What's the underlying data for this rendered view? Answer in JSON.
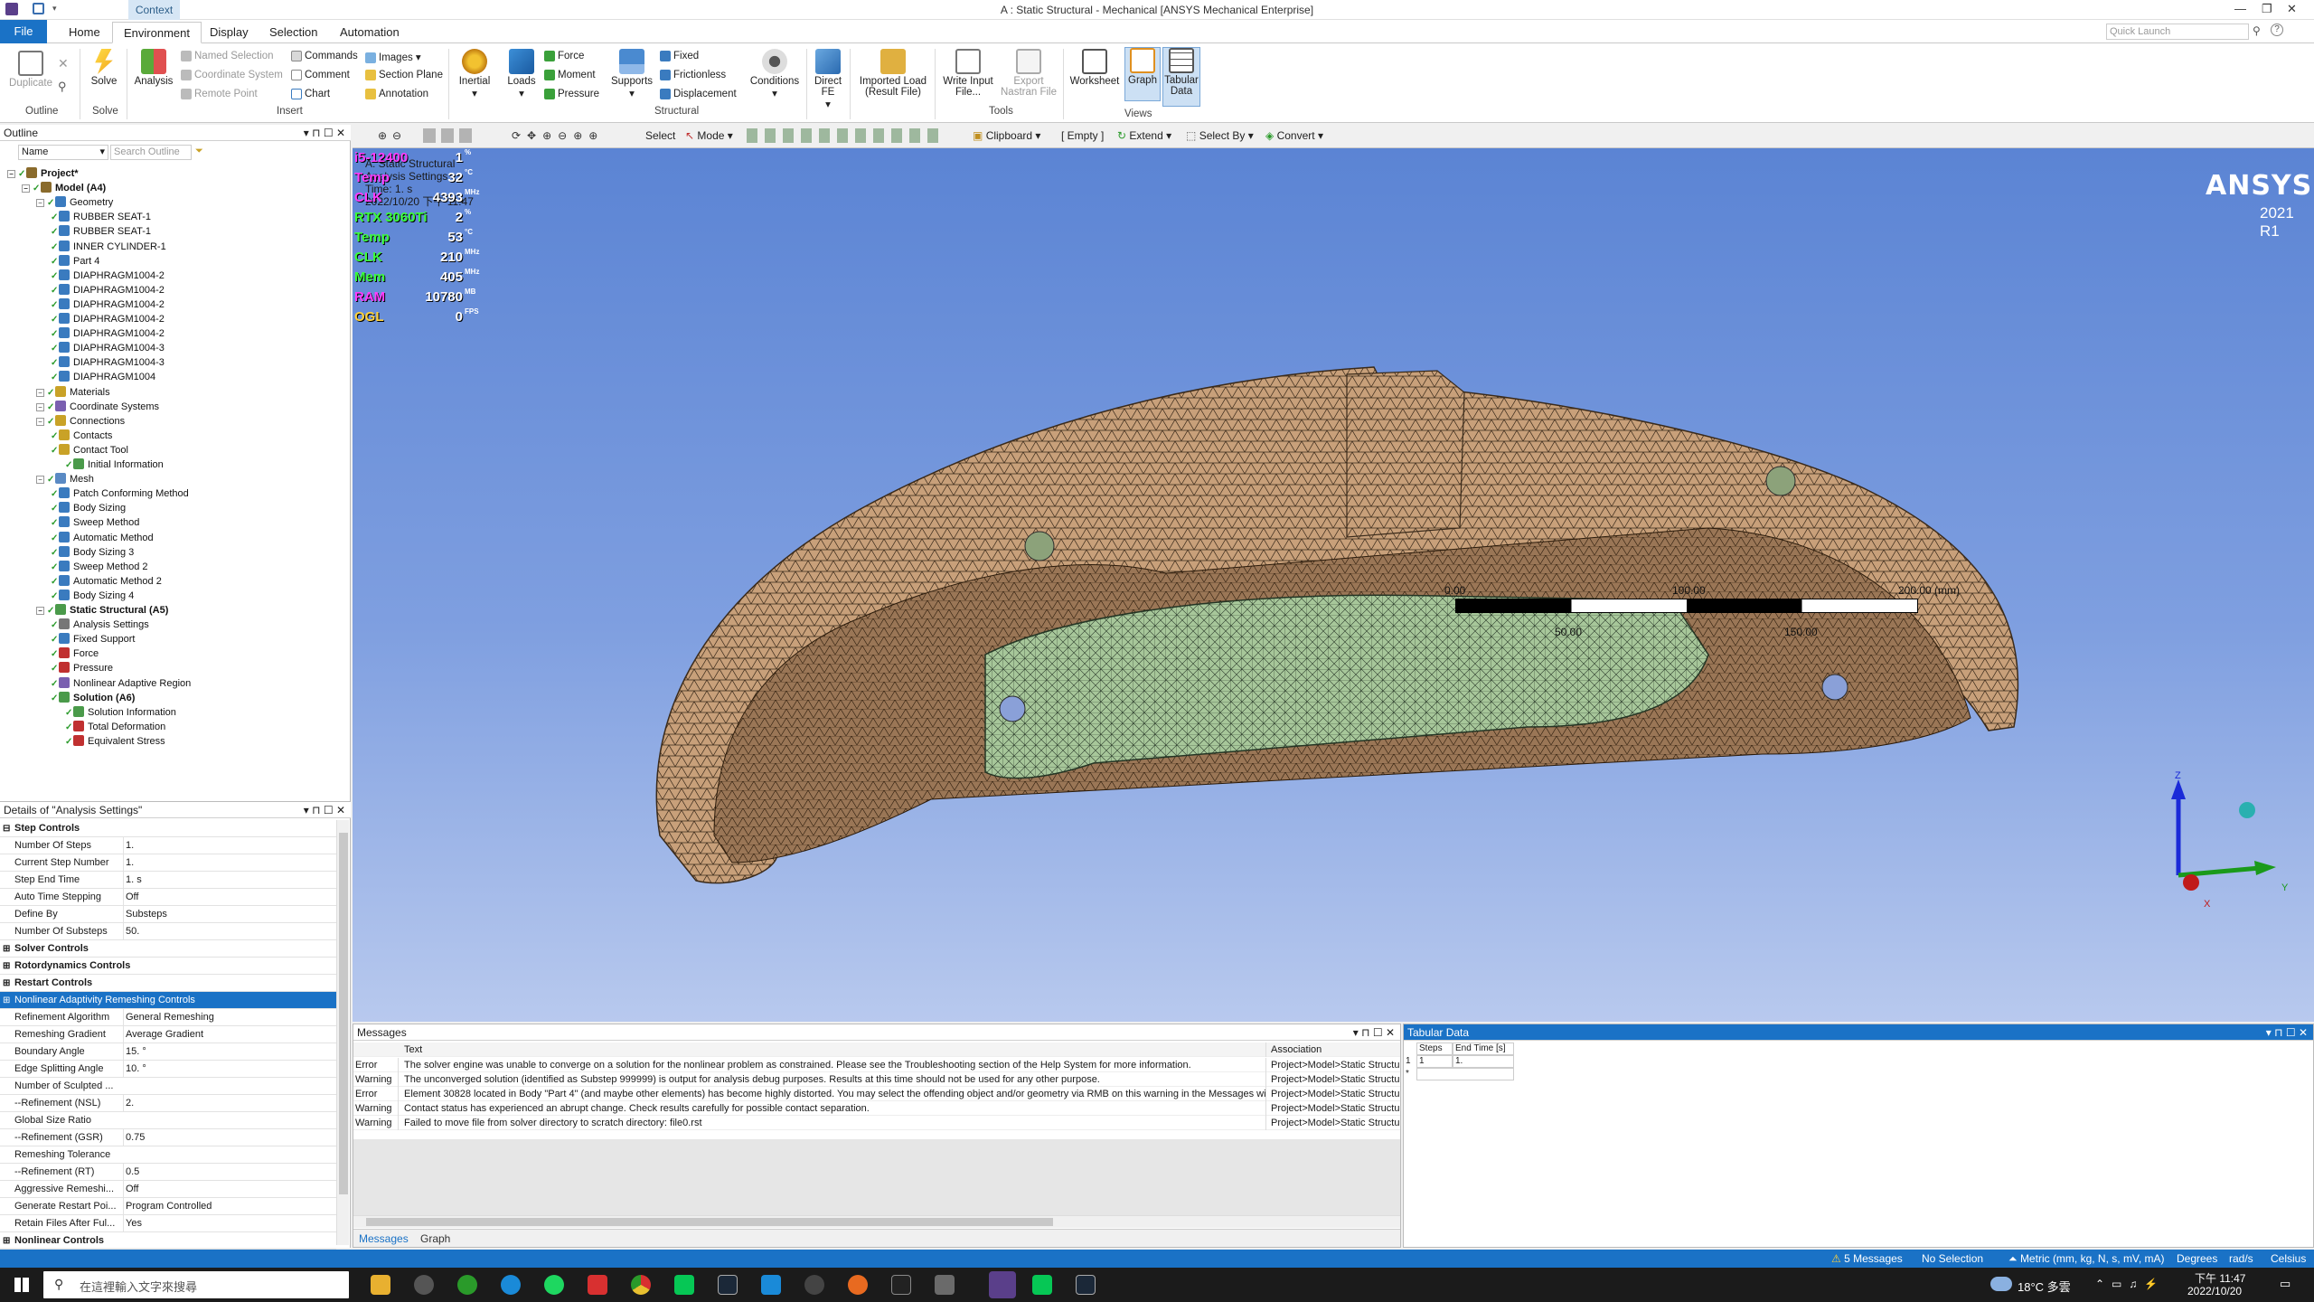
{
  "window": {
    "title": "A : Static Structural - Mechanical [ANSYS Mechanical Enterprise]",
    "context_tab": "Context",
    "quick_launch_placeholder": "Quick Launch"
  },
  "tabs": [
    "File",
    "Home",
    "Environment",
    "Display",
    "Selection",
    "Automation"
  ],
  "ribbon": {
    "duplicate": "Duplicate",
    "solve": "Solve",
    "analysis": "Analysis",
    "named_selection": "Named Selection",
    "coordinate_system": "Coordinate System",
    "remote_point": "Remote Point",
    "commands": "Commands",
    "comment": "Comment",
    "chart": "Chart",
    "images": "Images",
    "section_plane": "Section Plane",
    "annotation": "Annotation",
    "inertial": "Inertial",
    "loads": "Loads",
    "force": "Force",
    "moment": "Moment",
    "pressure": "Pressure",
    "supports": "Supports",
    "fixed": "Fixed",
    "frictionless": "Frictionless",
    "displacement": "Displacement",
    "conditions": "Conditions",
    "direct_fe": "Direct FE",
    "imported_load": "Imported Load (Result File)",
    "write_input": "Write Input File...",
    "export_nastran": "Export Nastran File",
    "nas_label": ".nas",
    "worksheet": "Worksheet",
    "graph": "Graph",
    "tabular_data": "Tabular Data",
    "groups": {
      "outline": "Outline",
      "solve": "Solve",
      "insert": "Insert",
      "structural": "Structural",
      "tools": "Tools",
      "views": "Views"
    }
  },
  "outline": {
    "title": "Outline",
    "name_label": "Name",
    "search_placeholder": "Search Outline",
    "nodes": [
      {
        "label": "Project*",
        "depth": 0,
        "bold": true,
        "icon": "project-icon",
        "color": "#8a6b2c"
      },
      {
        "label": "Model (A4)",
        "depth": 1,
        "bold": true,
        "icon": "model-icon",
        "color": "#8a6b2c"
      },
      {
        "label": "Geometry",
        "depth": 2,
        "bold": false,
        "icon": "geometry-icon",
        "color": "#3a7bbf"
      },
      {
        "label": "RUBBER SEAT-1",
        "depth": 3,
        "icon": "body-icon",
        "color": "#3a7bbf"
      },
      {
        "label": "RUBBER SEAT-1",
        "depth": 3,
        "icon": "body-icon",
        "color": "#3a7bbf"
      },
      {
        "label": "INNER CYLINDER-1",
        "depth": 3,
        "icon": "body-icon",
        "color": "#3a7bbf"
      },
      {
        "label": "Part 4",
        "depth": 3,
        "icon": "body-icon",
        "color": "#3a7bbf"
      },
      {
        "label": "DIAPHRAGM1004-2",
        "depth": 3,
        "icon": "body-icon",
        "color": "#3a7bbf"
      },
      {
        "label": "DIAPHRAGM1004-2",
        "depth": 3,
        "icon": "body-icon",
        "color": "#3a7bbf"
      },
      {
        "label": "DIAPHRAGM1004-2",
        "depth": 3,
        "icon": "body-icon",
        "color": "#3a7bbf"
      },
      {
        "label": "DIAPHRAGM1004-2",
        "depth": 3,
        "icon": "body-icon",
        "color": "#3a7bbf"
      },
      {
        "label": "DIAPHRAGM1004-2",
        "depth": 3,
        "icon": "body-icon",
        "color": "#3a7bbf"
      },
      {
        "label": "DIAPHRAGM1004-3",
        "depth": 3,
        "icon": "body-icon",
        "color": "#3a7bbf"
      },
      {
        "label": "DIAPHRAGM1004-3",
        "depth": 3,
        "icon": "body-icon",
        "color": "#3a7bbf"
      },
      {
        "label": "DIAPHRAGM1004",
        "depth": 3,
        "icon": "body-icon",
        "color": "#3a7bbf"
      },
      {
        "label": "Materials",
        "depth": 2,
        "icon": "materials-icon",
        "color": "#c9a227"
      },
      {
        "label": "Coordinate Systems",
        "depth": 2,
        "icon": "coordinate-icon",
        "color": "#7a5fb0"
      },
      {
        "label": "Connections",
        "depth": 2,
        "icon": "connections-icon",
        "color": "#c9a227"
      },
      {
        "label": "Contacts",
        "depth": 3,
        "icon": "contacts-icon",
        "color": "#c9a227"
      },
      {
        "label": "Contact Tool",
        "depth": 3,
        "icon": "contact-tool-icon",
        "color": "#c9a227"
      },
      {
        "label": "Initial Information",
        "depth": 4,
        "icon": "info-icon",
        "color": "#4a9a4a"
      },
      {
        "label": "Mesh",
        "depth": 2,
        "icon": "mesh-icon",
        "color": "#5a8ac4"
      },
      {
        "label": "Patch Conforming Method",
        "depth": 3,
        "icon": "method-icon",
        "color": "#3a7bbf"
      },
      {
        "label": "Body Sizing",
        "depth": 3,
        "icon": "sizing-icon",
        "color": "#3a7bbf"
      },
      {
        "label": "Sweep Method",
        "depth": 3,
        "icon": "method-icon",
        "color": "#3a7bbf"
      },
      {
        "label": "Automatic Method",
        "depth": 3,
        "icon": "method-icon",
        "color": "#3a7bbf"
      },
      {
        "label": "Body Sizing 3",
        "depth": 3,
        "icon": "sizing-icon",
        "color": "#3a7bbf"
      },
      {
        "label": "Sweep Method 2",
        "depth": 3,
        "icon": "method-icon",
        "color": "#3a7bbf"
      },
      {
        "label": "Automatic Method 2",
        "depth": 3,
        "icon": "method-icon",
        "color": "#3a7bbf"
      },
      {
        "label": "Body Sizing 4",
        "depth": 3,
        "icon": "sizing-icon",
        "color": "#3a7bbf"
      },
      {
        "label": "Static Structural (A5)",
        "depth": 2,
        "bold": true,
        "icon": "static-structural-icon",
        "color": "#4a9a4a"
      },
      {
        "label": "Analysis Settings",
        "depth": 3,
        "icon": "settings-icon",
        "color": "#777"
      },
      {
        "label": "Fixed Support",
        "depth": 3,
        "icon": "fixed-support-icon",
        "color": "#3a7bbf"
      },
      {
        "label": "Force",
        "depth": 3,
        "icon": "force-icon",
        "color": "#c03030"
      },
      {
        "label": "Pressure",
        "depth": 3,
        "icon": "pressure-icon",
        "color": "#c03030"
      },
      {
        "label": "Nonlinear Adaptive Region",
        "depth": 3,
        "icon": "region-icon",
        "color": "#7a5fb0"
      },
      {
        "label": "Solution (A6)",
        "depth": 3,
        "bold": true,
        "icon": "solution-icon",
        "color": "#4a9a4a"
      },
      {
        "label": "Solution Information",
        "depth": 4,
        "icon": "solution-info-icon",
        "color": "#4a9a4a"
      },
      {
        "label": "Total Deformation",
        "depth": 4,
        "icon": "deformation-icon",
        "color": "#c03030"
      },
      {
        "label": "Equivalent Stress",
        "depth": 4,
        "icon": "stress-icon",
        "color": "#c03030"
      }
    ]
  },
  "details": {
    "title": "Details of \"Analysis Settings\"",
    "rows": [
      {
        "type": "section",
        "key": "Step Controls"
      },
      {
        "key": "Number Of Steps",
        "value": "1."
      },
      {
        "key": "Current Step Number",
        "value": "1."
      },
      {
        "key": "Step End Time",
        "value": "1. s"
      },
      {
        "key": "Auto Time Stepping",
        "value": "Off"
      },
      {
        "key": "Define By",
        "value": "Substeps"
      },
      {
        "key": "Number Of Substeps",
        "value": "50."
      },
      {
        "type": "section",
        "key": "Solver Controls"
      },
      {
        "type": "section",
        "key": "Rotordynamics Controls"
      },
      {
        "type": "section",
        "key": "Restart Controls"
      },
      {
        "type": "section-selected",
        "key": "Nonlinear Adaptivity Remeshing Controls"
      },
      {
        "key": "Refinement Algorithm",
        "value": "General Remeshing"
      },
      {
        "key": "Remeshing Gradient",
        "value": "Average Gradient"
      },
      {
        "key": "Boundary Angle",
        "value": "15. °"
      },
      {
        "key": "Edge Splitting Angle",
        "value": "10. °"
      },
      {
        "key": "Number of Sculpted ...",
        "value": ""
      },
      {
        "key": "--Refinement (NSL)",
        "value": "2."
      },
      {
        "key": "Global Size Ratio",
        "value": ""
      },
      {
        "key": "--Refinement (GSR)",
        "value": "0.75"
      },
      {
        "key": "Remeshing Tolerance",
        "value": ""
      },
      {
        "key": "--Refinement (RT)",
        "value": "0.5"
      },
      {
        "key": "Aggressive Remeshi...",
        "value": "Off"
      },
      {
        "key": "Generate Restart Poi...",
        "value": "Program Controlled"
      },
      {
        "key": "Retain Files After Ful...",
        "value": "Yes"
      },
      {
        "type": "section",
        "key": "Nonlinear Controls"
      }
    ]
  },
  "graphics_toolbar": {
    "select": "Select",
    "mode": "Mode",
    "clipboard": "Clipboard",
    "empty": "[ Empty ]",
    "extend": "Extend",
    "select_by": "Select By",
    "convert": "Convert"
  },
  "viewport": {
    "overlay_header": [
      "A: Static Structural",
      "Analysis Settings",
      "Time: 1. s",
      "2022/10/20 下午 11:47"
    ],
    "brand": "ANSYS",
    "version": "2021 R1",
    "osd": [
      {
        "label": "i5-12400",
        "value": "1",
        "unit": "%",
        "color": "#ff3cff"
      },
      {
        "label": "Temp",
        "value": "32",
        "unit": "°C",
        "color": "#ff3cff"
      },
      {
        "label": "CLK",
        "value": "4393",
        "unit": "MHz",
        "color": "#ff3cff"
      },
      {
        "label": "RTX 3060Ti",
        "value": "2",
        "unit": "%",
        "color": "#3cff3c"
      },
      {
        "label": "Temp",
        "value": "53",
        "unit": "°C",
        "color": "#3cff3c"
      },
      {
        "label": "CLK",
        "value": "210",
        "unit": "MHz",
        "color": "#3cff3c"
      },
      {
        "label": "Mem",
        "value": "405",
        "unit": "MHz",
        "color": "#3cff3c"
      },
      {
        "label": "RAM",
        "value": "10780",
        "unit": "MB",
        "color": "#ff3cff"
      },
      {
        "label": "OGL",
        "value": "0",
        "unit": "FPS",
        "color": "#ffd23c"
      }
    ],
    "scale_top": [
      "0.00",
      "100.00",
      "200.00 (mm)"
    ],
    "scale_bottom": [
      "50.00",
      "150.00"
    ],
    "axes": {
      "z": "Z",
      "y": "Y",
      "x": "X"
    }
  },
  "messages": {
    "title": "Messages",
    "col_text": "Text",
    "col_assoc": "Association",
    "rows": [
      {
        "type": "Error",
        "text": "The solver engine was unable to converge on a solution for the nonlinear problem as constrained.  Please see the Troubleshooting section of the Help System for more information.",
        "assoc": "Project>Model>Static Structural>Solu"
      },
      {
        "type": "Warning",
        "text": "The unconverged solution (identified as Substep 999999) is output for analysis debug purposes.  Results at this time should not be used for any other purpose.",
        "assoc": "Project>Model>Static Structural>Solu"
      },
      {
        "type": "Error",
        "text": "Element 30828 located in Body \"Part 4\" (and maybe other elements) has become highly distorted.  You may select the offending object and/or geometry via RMB on this warning in the Messages window.",
        "assoc": "Project>Model>Static Structural>Solu"
      },
      {
        "type": "Warning",
        "text": "Contact status has experienced an abrupt change.  Check results carefully for possible contact separation.",
        "assoc": "Project>Model>Static Structural>Solu"
      },
      {
        "type": "Warning",
        "text": "Failed to move file from solver directory to scratch directory: file0.rst",
        "assoc": "Project>Model>Static Structural>Anal"
      }
    ],
    "tab_messages": "Messages",
    "tab_graph": "Graph"
  },
  "tabular": {
    "title": "Tabular Data",
    "col_steps": "Steps",
    "col_end_time": "End Time [s]",
    "row_index": "1",
    "row_steps": "1",
    "row_end": "1.",
    "new_row": "*"
  },
  "status": {
    "messages": "5 Messages",
    "selection": "No Selection",
    "units": "Metric (mm, kg, N, s, mV, mA)",
    "angle": "Degrees",
    "rate": "rad/s",
    "temp": "Celsius"
  },
  "taskbar": {
    "search_placeholder": "在這裡輸入文字來搜尋",
    "weather": "18°C 多雲",
    "time": "下午 11:47",
    "date": "2022/10/20"
  },
  "colors": {
    "accent": "#1a72c6",
    "mesh_tan": "#c8a07a",
    "mesh_green": "#a7c79a",
    "viewport_top": "#5b84d4",
    "viewport_bottom": "#b8c9ee"
  }
}
